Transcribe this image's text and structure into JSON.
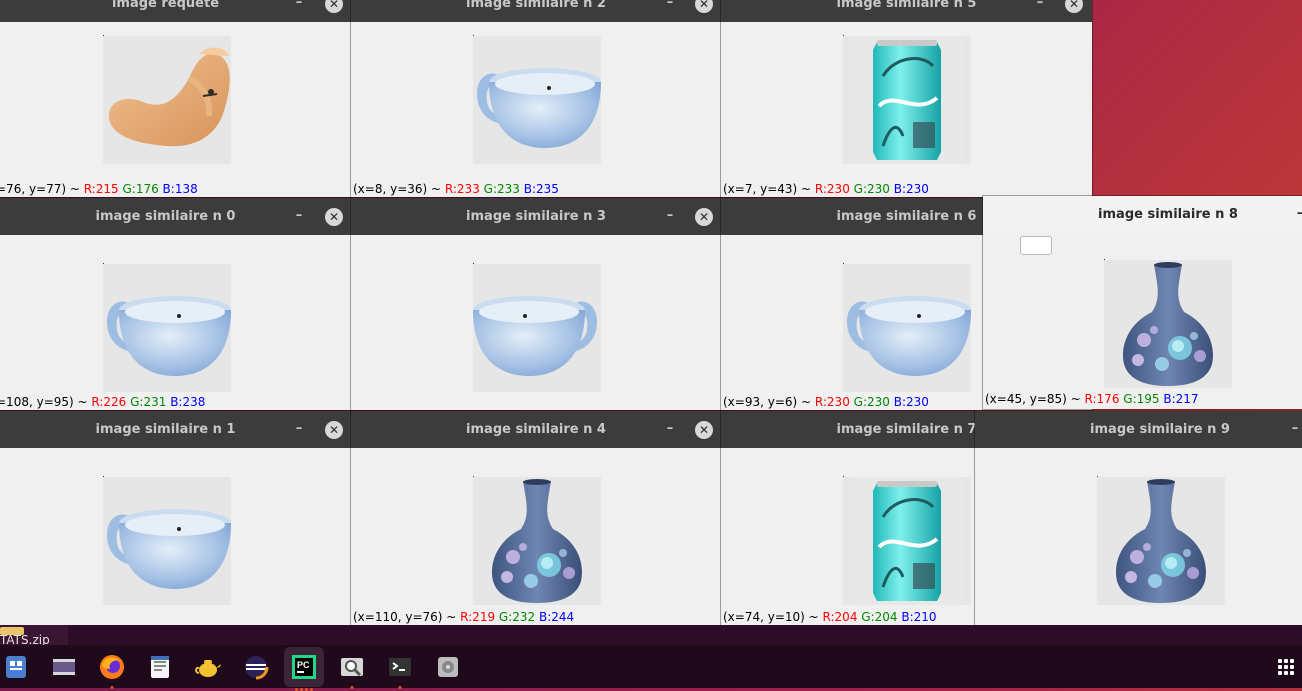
{
  "windows": {
    "requete": {
      "title": "image requete",
      "coords": "=76, y=77) ~ ",
      "r": "R:215",
      "g": " G:176",
      "b": " B:138"
    },
    "n2": {
      "title": "image similaire n 2",
      "coords": "(x=8, y=36) ~ ",
      "r": "R:233",
      "g": " G:233",
      "b": " B:235"
    },
    "n5": {
      "title": "image similaire n 5",
      "coords": "(x=7, y=43) ~ ",
      "r": "R:230",
      "g": " G:230",
      "b": " B:230"
    },
    "n0": {
      "title": "image similaire n 0",
      "coords": "=108, y=95) ~ ",
      "r": "R:226",
      "g": " G:231",
      "b": " B:238"
    },
    "n3": {
      "title": "image similaire n 3"
    },
    "n6": {
      "title": "image similaire n 6",
      "coords": "(x=93, y=6) ~ ",
      "r": "R:230",
      "g": " G:230",
      "b": " B:230"
    },
    "n8": {
      "title": "image similaire n 8",
      "coords": "(x=45, y=85) ~ ",
      "r": "R:176",
      "g": " G:195",
      "b": " B:217"
    },
    "n1": {
      "title": "image similaire n 1"
    },
    "n4": {
      "title": "image similaire n 4",
      "coords": "(x=110, y=76) ~ ",
      "r": "R:219",
      "g": " G:232",
      "b": " B:244"
    },
    "n7": {
      "title": "image similaire n 7",
      "coords": "(x=74, y=10) ~ ",
      "r": "R:204",
      "g": " G:204",
      "b": " B:210"
    },
    "n9": {
      "title": "image similaire n 9"
    }
  },
  "window_controls": {
    "minimize": "–",
    "close": "✕"
  },
  "desktop": {
    "zip_label": "TATS.zip"
  },
  "dock": {
    "items": [
      "files-icon",
      "video-icon",
      "firefox-icon",
      "text-editor-icon",
      "teapot-icon",
      "eclipse-icon",
      "pycharm-icon",
      "image-viewer-icon",
      "terminal-icon",
      "disk-icon"
    ],
    "pycharm_label": "PC"
  },
  "colors": {
    "titlebar": "#3c3c3c",
    "focused_titlebar": "#f3f3f3",
    "r": "#ff0000",
    "g": "#008800",
    "b": "#0000ff",
    "accent": "#e95420"
  }
}
